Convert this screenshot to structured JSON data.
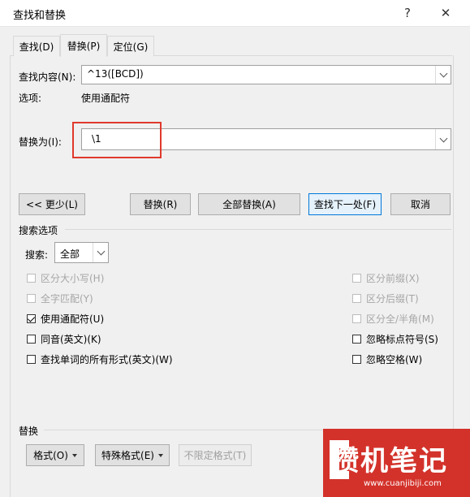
{
  "window": {
    "title": "查找和替换",
    "help": "?",
    "close": "✕"
  },
  "tabs": [
    {
      "label": "查找(D)",
      "active": false
    },
    {
      "label": "替换(P)",
      "active": true
    },
    {
      "label": "定位(G)",
      "active": false
    }
  ],
  "find": {
    "label": "查找内容(N):",
    "value": "^13([BCD])"
  },
  "options": {
    "label": "选项:",
    "value": "使用通配符"
  },
  "replace": {
    "label": "替换为(I):",
    "value": "\\1"
  },
  "buttons": {
    "less": "<< 更少(L)",
    "replace": "替换(R)",
    "replace_all": "全部替换(A)",
    "find_next": "查找下一处(F)",
    "cancel": "取消"
  },
  "search_options": {
    "section_label": "搜索选项",
    "search_label": "搜索:",
    "search_value": "全部",
    "left_checks": [
      {
        "label": "区分大小写(H)",
        "checked": false,
        "disabled": true
      },
      {
        "label": "全字匹配(Y)",
        "checked": false,
        "disabled": true
      },
      {
        "label": "使用通配符(U)",
        "checked": true,
        "disabled": false
      },
      {
        "label": "同音(英文)(K)",
        "checked": false,
        "disabled": false
      },
      {
        "label": "查找单词的所有形式(英文)(W)",
        "checked": false,
        "disabled": false
      }
    ],
    "right_checks": [
      {
        "label": "区分前缀(X)",
        "checked": false,
        "disabled": true
      },
      {
        "label": "区分后缀(T)",
        "checked": false,
        "disabled": true
      },
      {
        "label": "区分全/半角(M)",
        "checked": false,
        "disabled": true
      },
      {
        "label": "忽略标点符号(S)",
        "checked": false,
        "disabled": false
      },
      {
        "label": "忽略空格(W)",
        "checked": false,
        "disabled": false
      }
    ]
  },
  "replace_section": {
    "label": "替换",
    "format": "格式(O)",
    "special": "特殊格式(E)",
    "no_format": "不限定格式(T)"
  },
  "watermark": {
    "text": "攒机笔记",
    "url": "www.cuanjibiji.com"
  }
}
